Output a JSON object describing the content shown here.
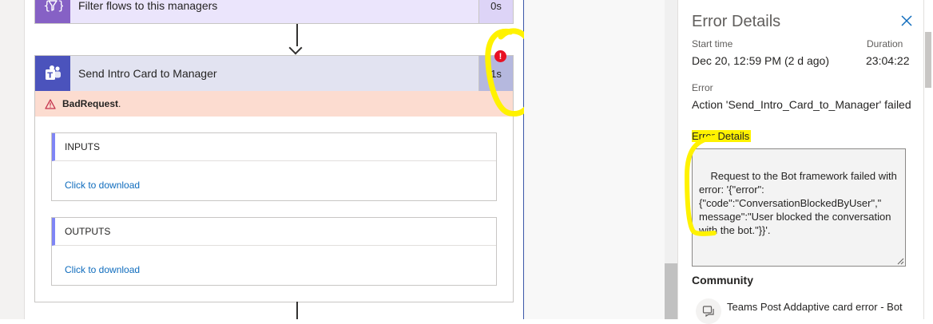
{
  "flow": {
    "filter_action": {
      "title": "Filter flows to this managers",
      "duration": "0s",
      "icon": "filter-braces-icon"
    },
    "teams_action": {
      "title": "Send Intro Card to Manager",
      "duration": "1s",
      "icon": "teams-icon",
      "error_badge": "!",
      "error_message": "BadRequest",
      "error_suffix": ".",
      "inputs": {
        "label": "INPUTS",
        "link": "Click to download"
      },
      "outputs": {
        "label": "OUTPUTS",
        "link": "Click to download"
      }
    }
  },
  "panel": {
    "title": "Error Details",
    "start_time_label": "Start time",
    "start_time_value": "Dec 20, 12:59 PM (2 d ago)",
    "duration_label": "Duration",
    "duration_value": "23:04:22",
    "error_label": "Error",
    "error_value": "Action 'Send_Intro_Card_to_Manager' failed",
    "error_details_label": "Error Details",
    "error_details_text": "Request to the Bot framework failed with error: '{\"error\": {\"code\":\"ConversationBlockedByUser\",\" message\":\"User blocked the conversation with the bot.\"}}'.",
    "community_label": "Community",
    "community_item": "Teams Post Addaptive card error - Bot"
  },
  "colors": {
    "filter_accent": "#8661c5",
    "teams_accent": "#4b53bc",
    "error_banner": "#fcdcd0",
    "error_badge": "#e81123",
    "link": "#0f6cbd",
    "highlight": "#fff200"
  }
}
